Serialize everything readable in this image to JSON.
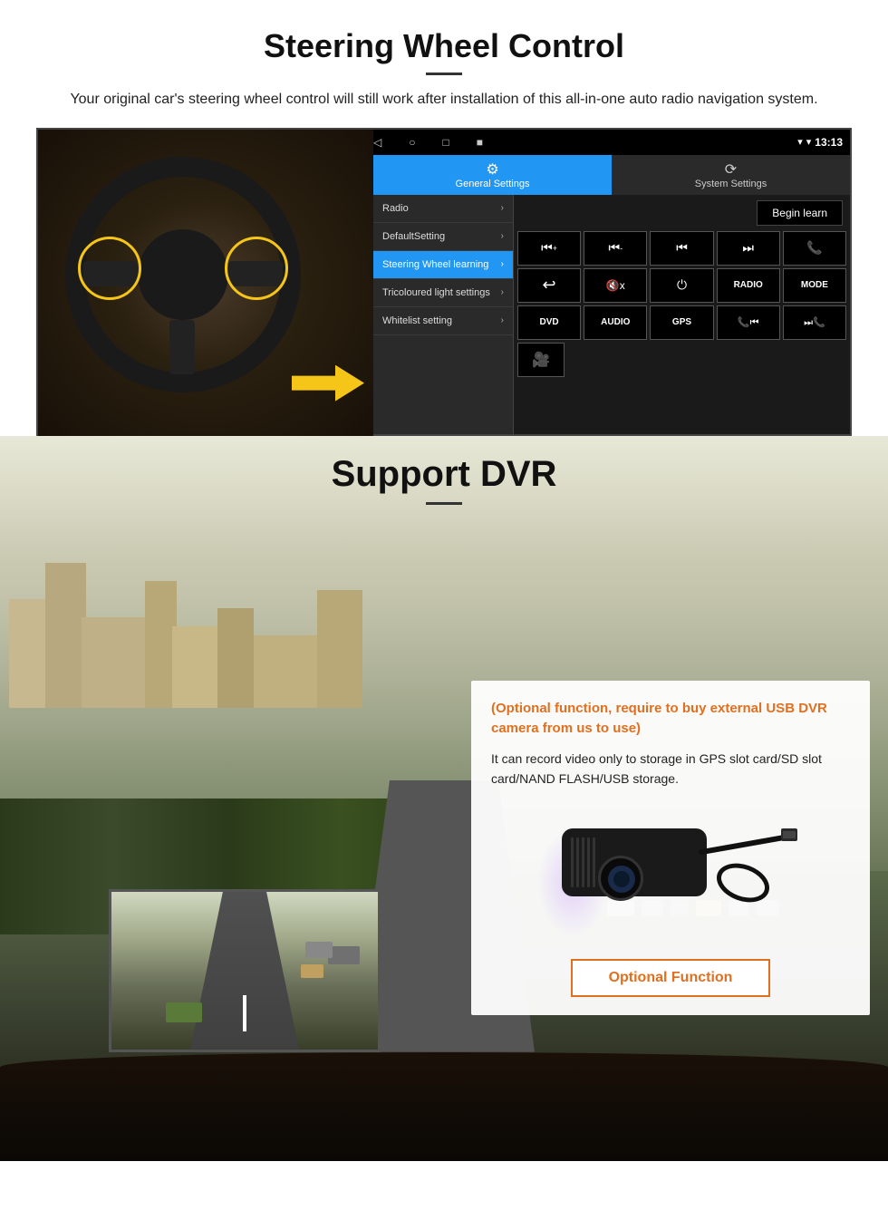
{
  "page": {
    "steering_wheel_section": {
      "title": "Steering Wheel Control",
      "description": "Your original car's steering wheel control will still work after installation of this all-in-one auto radio navigation system.",
      "status_bar": {
        "time": "13:13",
        "signal_icon": "▾",
        "wifi_icon": "▾",
        "battery_icon": "▮"
      },
      "nav_bar": {
        "back_icon": "◁",
        "home_icon": "○",
        "recents_icon": "□",
        "menu_icon": "■"
      },
      "tab_general": {
        "label": "General Settings",
        "icon": "⚙"
      },
      "tab_system": {
        "label": "System Settings",
        "icon": "🔄"
      },
      "settings_items": [
        {
          "label": "Radio",
          "active": false
        },
        {
          "label": "DefaultSetting",
          "active": false
        },
        {
          "label": "Steering Wheel learning",
          "active": true
        },
        {
          "label": "Tricoloured light settings",
          "active": false
        },
        {
          "label": "Whitelist setting",
          "active": false
        }
      ],
      "begin_learn_btn": "Begin learn",
      "control_buttons_row1": [
        {
          "icon": "⏮+",
          "label": "vol_up"
        },
        {
          "icon": "⏮-",
          "label": "vol_down"
        },
        {
          "icon": "⏮",
          "label": "prev"
        },
        {
          "icon": "⏭",
          "label": "next"
        },
        {
          "icon": "📞",
          "label": "call"
        }
      ],
      "control_buttons_row2": [
        {
          "icon": "↩",
          "label": "hang_up"
        },
        {
          "icon": "🔇x",
          "label": "mute"
        },
        {
          "icon": "⏻",
          "label": "power"
        },
        {
          "text": "RADIO",
          "label": "radio_btn"
        },
        {
          "text": "MODE",
          "label": "mode_btn"
        }
      ],
      "control_buttons_row3": [
        {
          "text": "DVD",
          "label": "dvd_btn"
        },
        {
          "text": "AUDIO",
          "label": "audio_btn"
        },
        {
          "text": "GPS",
          "label": "gps_btn"
        },
        {
          "icon": "📞⏮",
          "label": "call_prev"
        },
        {
          "icon": "⏭📞",
          "label": "call_next"
        }
      ],
      "control_buttons_row4": [
        {
          "icon": "📷",
          "label": "camera_btn"
        }
      ]
    },
    "dvr_section": {
      "title": "Support DVR",
      "optional_text": "(Optional function, require to buy external USB DVR camera from us to use)",
      "description": "It can record video only to storage in GPS slot card/SD slot card/NAND FLASH/USB storage.",
      "optional_function_btn": "Optional Function"
    }
  }
}
